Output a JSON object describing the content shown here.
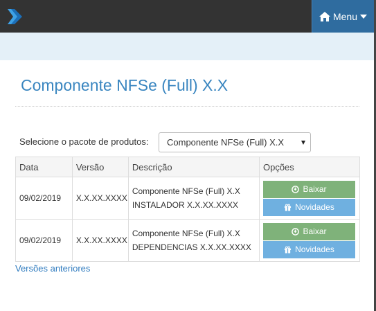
{
  "header": {
    "menu_label": "Menu",
    "colors": {
      "topbar": "#333333",
      "menu": "#2f6c9f",
      "logo": "#1c6fb8",
      "subbar": "#e4f0f8"
    }
  },
  "page": {
    "title": "Componente NFSe (Full) X.X"
  },
  "selector": {
    "label": "Selecione o pacote de produtos:",
    "selected": "Componente NFSe (Full) X.X"
  },
  "table": {
    "headers": [
      "Data",
      "Versão",
      "Descrição",
      "Opções"
    ],
    "rows": [
      {
        "date": "09/02/2019",
        "version": "X.X.XX.XXXX",
        "desc_line1": "Componente NFSe (Full) X.X",
        "desc_line2": "INSTALADOR X.X.XX.XXXX"
      },
      {
        "date": "09/02/2019",
        "version": "X.X.XX.XXXX",
        "desc_line1": "Componente NFSe (Full) X.X",
        "desc_line2": "DEPENDENCIAS X.X.XX.XXXX"
      }
    ],
    "download_label": "Baixar",
    "news_label": "Novidades",
    "colors": {
      "download": "#7fb27a",
      "news": "#6fb0e0"
    }
  },
  "footer": {
    "older_versions_link": "Versões anteriores"
  },
  "icons": [
    "logo-chevron-icon",
    "home-icon",
    "caret-down-icon",
    "download-circle-icon",
    "gift-icon"
  ]
}
